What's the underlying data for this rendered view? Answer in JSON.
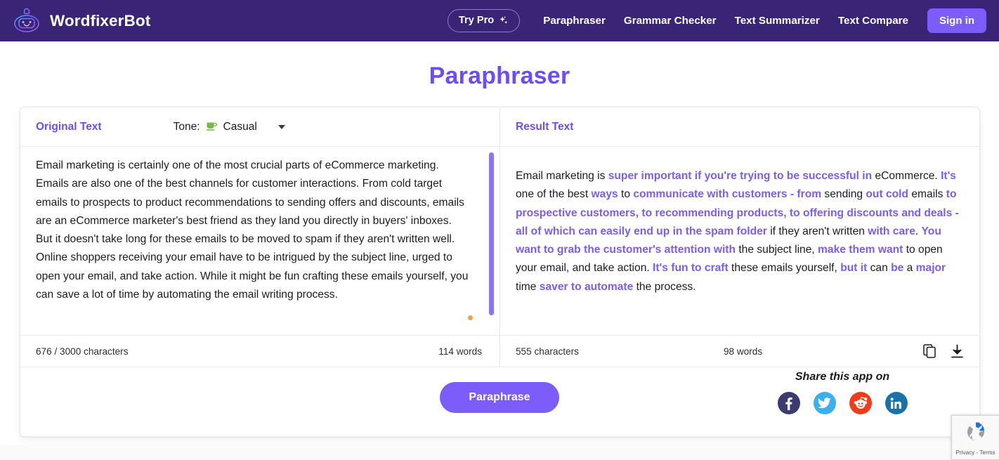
{
  "header": {
    "brand_name": "WordfixerBot",
    "logo_icon": "robot-icon",
    "try_pro_label": "Try Pro",
    "try_pro_icon": "sparkles-icon",
    "nav_links": [
      {
        "label": "Paraphraser"
      },
      {
        "label": "Grammar Checker"
      },
      {
        "label": "Text Summarizer"
      },
      {
        "label": "Text Compare"
      }
    ],
    "signin_label": "Sign in",
    "colors": {
      "navbar_bg": "#3a2475",
      "accent": "#7c5cfa"
    }
  },
  "page_title": "Paraphraser",
  "original_panel": {
    "label": "Original Text",
    "tone_label": "Tone:",
    "tone_emoji": "☕",
    "tone_value": "Casual",
    "caret_icon": "chevron-down-icon",
    "text": "Email marketing is certainly one of the most crucial parts of eCommerce marketing. Emails are also one of the best channels for customer interactions. From cold target emails to prospects to product recommendations to sending offers and discounts, emails are an eCommerce marketer's best friend as they land you directly in buyers' inboxes. But it doesn't take long for these emails to be moved to spam if they aren't written well. Online shoppers receiving your email have to be intrigued by the subject line, urged to open your email, and take action. While it might be fun crafting these emails yourself, you can save a lot of time by automating the email writing process.",
    "characters": "676 / 3000 characters",
    "words": "114 words"
  },
  "result_panel": {
    "label": "Result Text",
    "segments": [
      {
        "text": "Email marketing is ",
        "highlight": false
      },
      {
        "text": "super important if you're trying to be successful in",
        "highlight": true
      },
      {
        "text": " eCommerce. ",
        "highlight": false
      },
      {
        "text": "It's",
        "highlight": true
      },
      {
        "text": " one of the best ",
        "highlight": false
      },
      {
        "text": "ways",
        "highlight": true
      },
      {
        "text": " to ",
        "highlight": false
      },
      {
        "text": "communicate with customers - from",
        "highlight": true
      },
      {
        "text": " sending ",
        "highlight": false
      },
      {
        "text": "out cold",
        "highlight": true
      },
      {
        "text": " emails ",
        "highlight": false
      },
      {
        "text": "to prospective customers, to recommending products, to offering discounts and deals - all of which can easily end up in the spam folder",
        "highlight": true
      },
      {
        "text": " if they aren't written ",
        "highlight": false
      },
      {
        "text": "with care",
        "highlight": true
      },
      {
        "text": ". ",
        "highlight": false
      },
      {
        "text": "You want to grab the customer's attention with",
        "highlight": true
      },
      {
        "text": " the subject line, ",
        "highlight": false
      },
      {
        "text": "make them want",
        "highlight": true
      },
      {
        "text": " to open your email, and take action. ",
        "highlight": false
      },
      {
        "text": "It's fun to craft",
        "highlight": true
      },
      {
        "text": " these emails yourself, ",
        "highlight": false
      },
      {
        "text": "but it",
        "highlight": true
      },
      {
        "text": " can ",
        "highlight": false
      },
      {
        "text": "be",
        "highlight": true
      },
      {
        "text": " a ",
        "highlight": false
      },
      {
        "text": "major",
        "highlight": true
      },
      {
        "text": " time ",
        "highlight": false
      },
      {
        "text": "saver to automate",
        "highlight": true
      },
      {
        "text": " the process.",
        "highlight": false
      }
    ],
    "characters": "555 characters",
    "words": "98 words",
    "copy_icon": "copy-icon",
    "download_icon": "download-icon",
    "highlight_color": "#7b5cf5"
  },
  "actions": {
    "paraphrase_label": "Paraphrase",
    "share_title": "Share this app on",
    "share_buttons": [
      {
        "name": "facebook",
        "icon": "facebook-icon",
        "color": "#3b3b70"
      },
      {
        "name": "twitter",
        "icon": "twitter-icon",
        "color": "#3ab0ec"
      },
      {
        "name": "reddit",
        "icon": "reddit-icon",
        "color": "#f03c1c"
      },
      {
        "name": "linkedin",
        "icon": "linkedin-icon",
        "color": "#1a73a8"
      }
    ]
  },
  "recaptcha": {
    "text": "Privacy - Terms",
    "icon": "recaptcha-icon"
  }
}
